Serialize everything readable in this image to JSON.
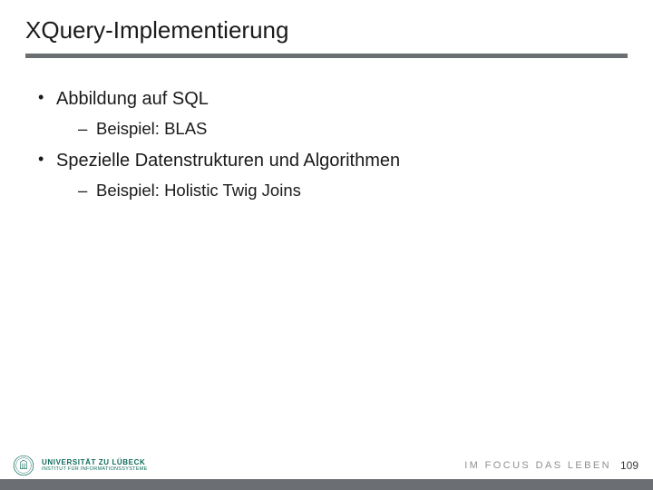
{
  "title": "XQuery-Implementierung",
  "bullets": {
    "b1": "Abbildung auf SQL",
    "b1_1": "Beispiel: BLAS",
    "b2": "Spezielle Datenstrukturen und Algorithmen",
    "b2_1": "Beispiel: Holistic Twig Joins"
  },
  "footer": {
    "university": "UNIVERSITÄT ZU LÜBECK",
    "institute": "INSTITUT FÜR INFORMATIONSSYSTEME",
    "motto": "IM FOCUS DAS LEBEN",
    "page": "109"
  }
}
